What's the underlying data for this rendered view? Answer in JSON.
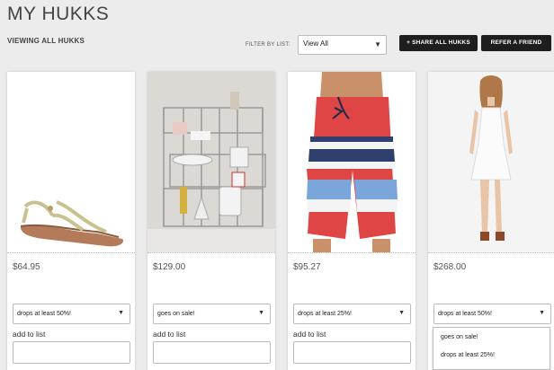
{
  "header": {
    "title": "MY HUKKS",
    "viewing": "VIEWING ALL HUKKS",
    "filter_label": "FILTER BY LIST:",
    "filter_value": "View All",
    "share_label": "+ SHARE ALL HUKKS",
    "refer_label": "REFER A FRIEND"
  },
  "products": [
    {
      "name": "sandal-image",
      "price": "$64.95",
      "alert": "drops at least 50%!",
      "add_label": "add to list"
    },
    {
      "name": "shelf-image",
      "price": "$129.00",
      "alert": "goes on sale!",
      "add_label": "add to list"
    },
    {
      "name": "shorts-image",
      "price": "$95.27",
      "alert": "drops at least 25%!",
      "add_label": "add to list"
    },
    {
      "name": "dress-image",
      "price": "$268.00",
      "alert": "drops at least 50%!",
      "add_label": "add to list"
    }
  ],
  "dropdown_options": [
    "goes on sale!",
    "drops at least 25%!"
  ],
  "colors": {
    "accent_dark": "#1e1e1e",
    "background": "#ececec"
  }
}
